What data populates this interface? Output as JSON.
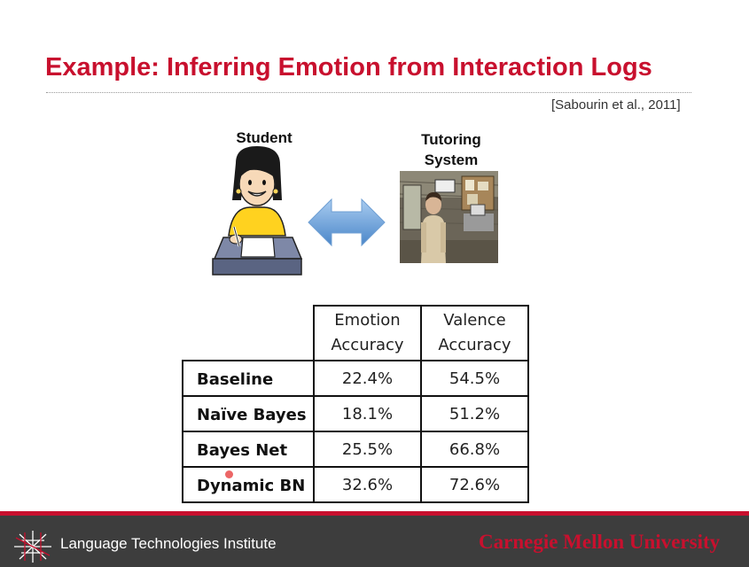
{
  "slide": {
    "title": "Example: Inferring Emotion from Interaction Logs",
    "citation": "[Sabourin et al., 2011]"
  },
  "diagram": {
    "student_label": "Student",
    "tutor_label_line1": "Tutoring",
    "tutor_label_line2": "System"
  },
  "table": {
    "headers": [
      {
        "line1": "Emotion",
        "line2": "Accuracy"
      },
      {
        "line1": "Valence",
        "line2": "Accuracy"
      }
    ],
    "rows": [
      {
        "name": "Baseline",
        "emotion": "22.4%",
        "valence": "54.5%"
      },
      {
        "name": "Naïve Bayes",
        "emotion": "18.1%",
        "valence": "51.2%"
      },
      {
        "name": "Bayes Net",
        "emotion": "25.5%",
        "valence": "66.8%"
      },
      {
        "name": "Dynamic BN",
        "emotion": "32.6%",
        "valence": "72.6%"
      }
    ]
  },
  "footer": {
    "institute": "Language Technologies Institute",
    "university": "Carnegie Mellon University"
  },
  "colors": {
    "title": "#c8102e",
    "footer_bg": "#3d3d3d",
    "footer_rule": "#c8102e",
    "arrow": "#5b9bd5"
  }
}
